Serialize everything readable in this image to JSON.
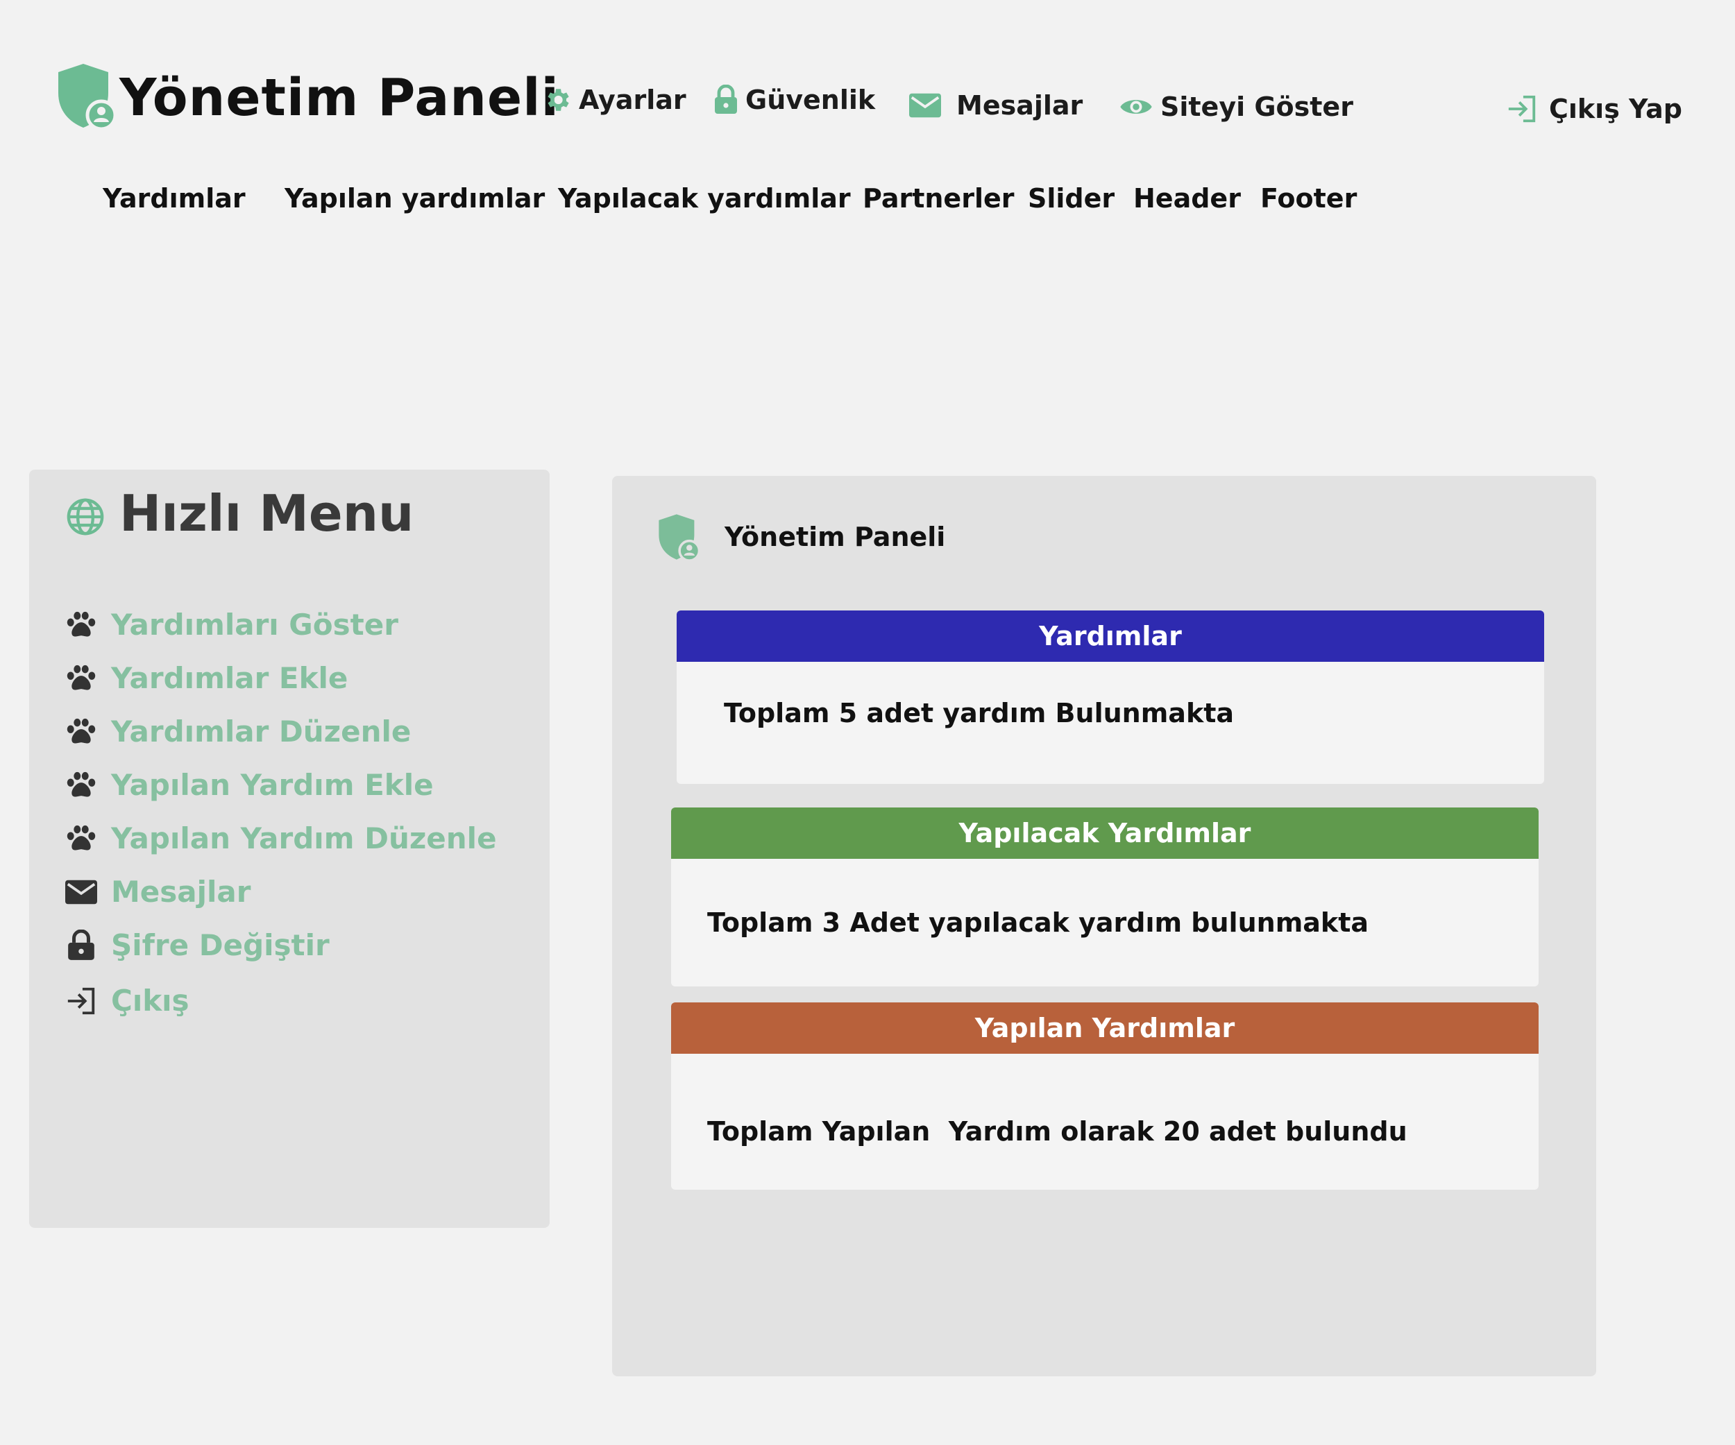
{
  "header": {
    "brand_title": "Yönetim Paneli",
    "links": {
      "settings": "Ayarlar",
      "security": "Güvenlik",
      "messages": "Mesajlar",
      "show_site": "Siteyi Göster",
      "logout": "Çıkış Yap"
    }
  },
  "subnav": {
    "items": [
      "Yardımlar",
      "Yapılan yardımlar",
      "Yapılacak yardımlar",
      "Partnerler",
      "Slider",
      "Header",
      "Footer"
    ]
  },
  "quick_menu": {
    "title": "Hızlı Menu",
    "items": [
      {
        "label": "Yardımları Göster",
        "icon": "paw-icon"
      },
      {
        "label": "Yardımlar Ekle",
        "icon": "paw-icon"
      },
      {
        "label": "Yardımlar Düzenle",
        "icon": "paw-icon"
      },
      {
        "label": "Yapılan Yardım Ekle",
        "icon": "paw-icon"
      },
      {
        "label": "Yapılan Yardım Düzenle",
        "icon": "paw-icon"
      },
      {
        "label": "Mesajlar",
        "icon": "envelope-icon"
      },
      {
        "label": "Şifre Değiştir",
        "icon": "lock-icon"
      },
      {
        "label": "Çıkış",
        "icon": "logout-icon"
      }
    ]
  },
  "main": {
    "title": "Yönetim Paneli",
    "cards": [
      {
        "header": "Yardımlar",
        "body": "Toplam 5 adet yardım Bulunmakta",
        "color": "#2e2ab0"
      },
      {
        "header": "Yapılacak Yardımlar",
        "body": "Toplam 3 Adet yapılacak yardım bulunmakta",
        "color": "#609a4d"
      },
      {
        "header": "Yapılan Yardımlar",
        "body": "Toplam Yapılan  Yardım olarak 20 adet bulundu",
        "color": "#b8613b"
      }
    ]
  },
  "colors": {
    "accent_green": "#6cbb93",
    "menu_text_green": "#86c0a0",
    "panel_bg": "#e2e2e2",
    "page_bg": "#f2f2f2"
  }
}
